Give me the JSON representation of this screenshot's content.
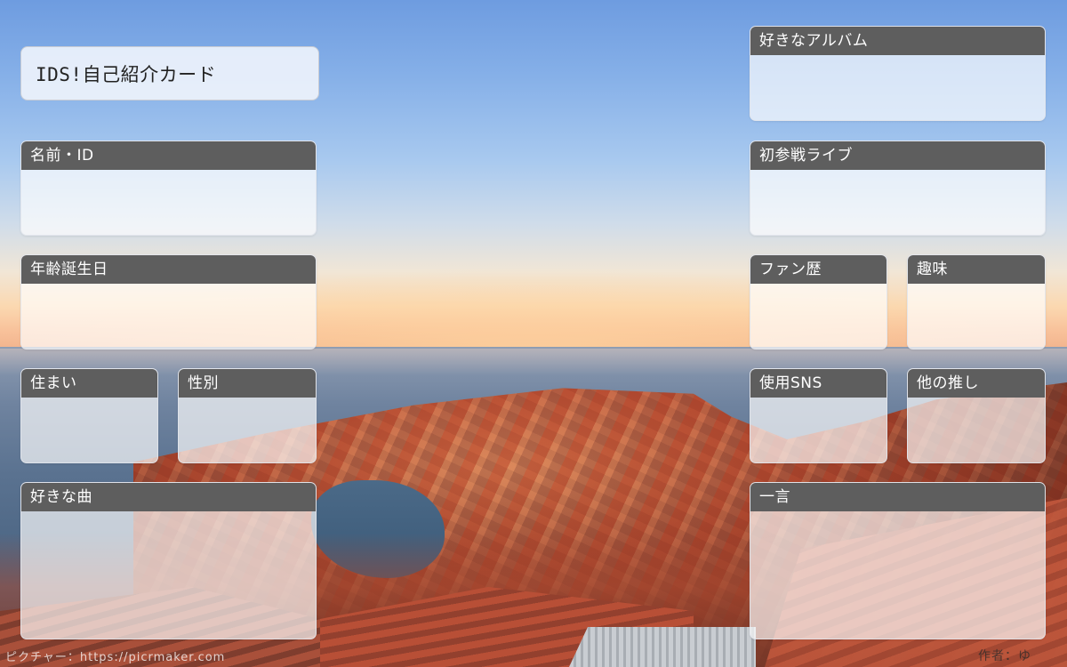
{
  "card": {
    "title": "IDS!自己紹介カード"
  },
  "fields": {
    "name_id": "名前・ID",
    "age_birthday": "年齢誕生日",
    "residence": "住まい",
    "gender": "性別",
    "favorite_song": "好きな曲",
    "favorite_album": "好きなアルバム",
    "first_live": "初参戦ライブ",
    "fan_history": "ファン歴",
    "hobby": "趣味",
    "sns_used": "使用SNS",
    "other_oshi": "他の推し",
    "one_word": "一言"
  },
  "footer": {
    "credit_left": "ピクチャー：https://picrmaker.com",
    "credit_right": "作者：ゆ"
  }
}
